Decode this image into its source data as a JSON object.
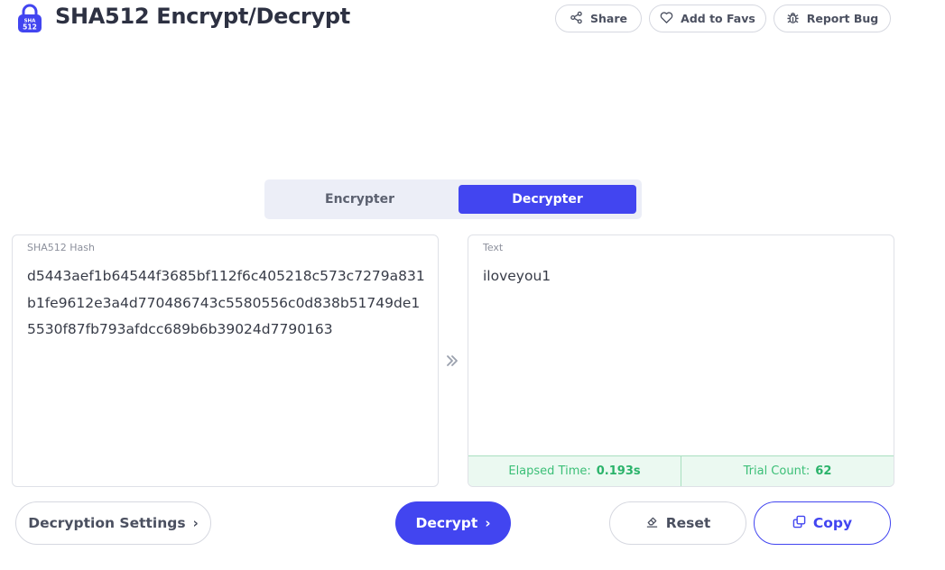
{
  "header": {
    "logo_text_top": "SHA",
    "logo_text_bottom": "512",
    "title": "SHA512 Encrypt/Decrypt",
    "share_label": "Share",
    "favs_label": "Add to Favs",
    "bug_label": "Report Bug"
  },
  "mode": {
    "tabs": [
      {
        "label": "Encrypter",
        "active": false
      },
      {
        "label": "Decrypter",
        "active": true
      }
    ]
  },
  "input": {
    "label": "SHA512 Hash",
    "value": "d5443aef1b64544f3685bf112f6c405218c573c7279a831b1fe9612e3a4d770486743c5580556c0d838b51749de15530f87fb793afdcc689b6b39024d7790163"
  },
  "output": {
    "label": "Text",
    "value": "iloveyou1",
    "elapsed_label": "Elapsed Time:",
    "elapsed_value": "0.193s",
    "trial_label": "Trial Count:",
    "trial_value": "62"
  },
  "actions": {
    "settings_label": "Decryption Settings",
    "decrypt_label": "Decrypt",
    "reset_label": "Reset",
    "copy_label": "Copy"
  },
  "icons": {
    "logo": "lock-icon",
    "share": "share-icon",
    "favs": "heart-icon",
    "bug": "bug-icon",
    "arrow": "double-chevron-right-icon",
    "reset": "eraser-icon",
    "copy": "copy-icon"
  },
  "colors": {
    "accent": "#4245f0",
    "success_bg": "#ebf9f1",
    "success_text": "#2ab36a"
  }
}
